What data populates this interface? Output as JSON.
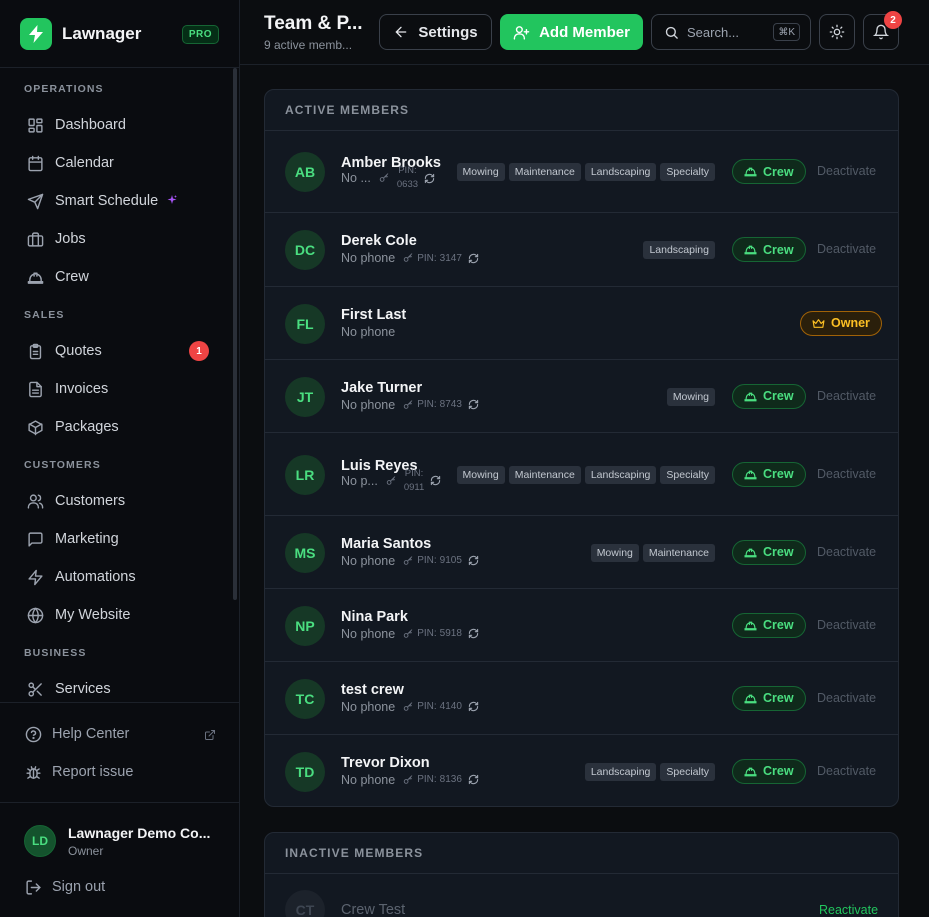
{
  "brand": {
    "name": "Lawnager",
    "plan_badge": "PRO"
  },
  "sidebar": {
    "sections": [
      {
        "title": "OPERATIONS",
        "items": [
          {
            "label": "Dashboard",
            "icon": "dashboard-icon"
          },
          {
            "label": "Calendar",
            "icon": "calendar-icon"
          },
          {
            "label": "Smart Schedule",
            "icon": "send-icon",
            "extra": "sparkle"
          },
          {
            "label": "Jobs",
            "icon": "briefcase-icon"
          },
          {
            "label": "Crew",
            "icon": "hard-hat-icon"
          }
        ]
      },
      {
        "title": "SALES",
        "items": [
          {
            "label": "Quotes",
            "icon": "clipboard-icon",
            "badge": "1"
          },
          {
            "label": "Invoices",
            "icon": "file-text-icon"
          },
          {
            "label": "Packages",
            "icon": "package-icon"
          }
        ]
      },
      {
        "title": "CUSTOMERS",
        "items": [
          {
            "label": "Customers",
            "icon": "users-icon"
          },
          {
            "label": "Marketing",
            "icon": "message-square-icon"
          },
          {
            "label": "Automations",
            "icon": "zap-icon"
          },
          {
            "label": "My Website",
            "icon": "globe-icon"
          }
        ]
      },
      {
        "title": "BUSINESS",
        "items": [
          {
            "label": "Services",
            "icon": "scissors-icon"
          }
        ]
      }
    ],
    "help_center": "Help Center",
    "report_issue": "Report issue",
    "user": {
      "initials": "LD",
      "name": "Lawnager Demo Co...",
      "role": "Owner"
    },
    "sign_out": "Sign out"
  },
  "header": {
    "title": "Team & P...",
    "subtitle": "9 active memb...",
    "settings_label": "Settings",
    "add_member_label": "Add Member",
    "search_placeholder": "Search...",
    "search_shortcut": "⌘K",
    "notification_count": "2"
  },
  "active_section": {
    "title": "ACTIVE MEMBERS",
    "members": [
      {
        "initials": "AB",
        "name": "Amber Brooks",
        "phone": "No ...",
        "pin_label": "PIN:",
        "pin": "0633",
        "pin_stacked": true,
        "tags": [
          "Mowing",
          "Maintenance",
          "Landscaping",
          "Specialty"
        ],
        "role": "Crew",
        "action": "Deactivate"
      },
      {
        "initials": "DC",
        "name": "Derek Cole",
        "phone": "No phone",
        "pin_label": "PIN:",
        "pin": "3147",
        "pin_stacked": false,
        "tags": [
          "Landscaping"
        ],
        "role": "Crew",
        "action": "Deactivate"
      },
      {
        "initials": "FL",
        "name": "First Last",
        "phone": "No phone",
        "pin_label": "",
        "pin": "",
        "pin_stacked": false,
        "tags": [],
        "role": "Owner",
        "action": ""
      },
      {
        "initials": "JT",
        "name": "Jake Turner",
        "phone": "No phone",
        "pin_label": "PIN:",
        "pin": "8743",
        "pin_stacked": false,
        "tags": [
          "Mowing"
        ],
        "role": "Crew",
        "action": "Deactivate"
      },
      {
        "initials": "LR",
        "name": "Luis Reyes",
        "phone": "No p...",
        "pin_label": "PIN:",
        "pin": "0911",
        "pin_stacked": true,
        "tags": [
          "Mowing",
          "Maintenance",
          "Landscaping",
          "Specialty"
        ],
        "role": "Crew",
        "action": "Deactivate"
      },
      {
        "initials": "MS",
        "name": "Maria Santos",
        "phone": "No phone",
        "pin_label": "PIN:",
        "pin": "9105",
        "pin_stacked": false,
        "tags": [
          "Mowing",
          "Maintenance"
        ],
        "role": "Crew",
        "action": "Deactivate"
      },
      {
        "initials": "NP",
        "name": "Nina Park",
        "phone": "No phone",
        "pin_label": "PIN:",
        "pin": "5918",
        "pin_stacked": false,
        "tags": [],
        "role": "Crew",
        "action": "Deactivate"
      },
      {
        "initials": "TC",
        "name": "test crew",
        "phone": "No phone",
        "pin_label": "PIN:",
        "pin": "4140",
        "pin_stacked": false,
        "tags": [],
        "role": "Crew",
        "action": "Deactivate"
      },
      {
        "initials": "TD",
        "name": "Trevor Dixon",
        "phone": "No phone",
        "pin_label": "PIN:",
        "pin": "8136",
        "pin_stacked": false,
        "tags": [
          "Landscaping",
          "Specialty"
        ],
        "role": "Crew",
        "action": "Deactivate"
      }
    ]
  },
  "inactive_section": {
    "title": "INACTIVE MEMBERS",
    "members": [
      {
        "initials": "CT",
        "name": "Crew Test",
        "action": "Reactivate"
      }
    ]
  },
  "colors": {
    "accent": "#22c55e",
    "owner": "#fbbf24",
    "danger": "#ef4444"
  }
}
